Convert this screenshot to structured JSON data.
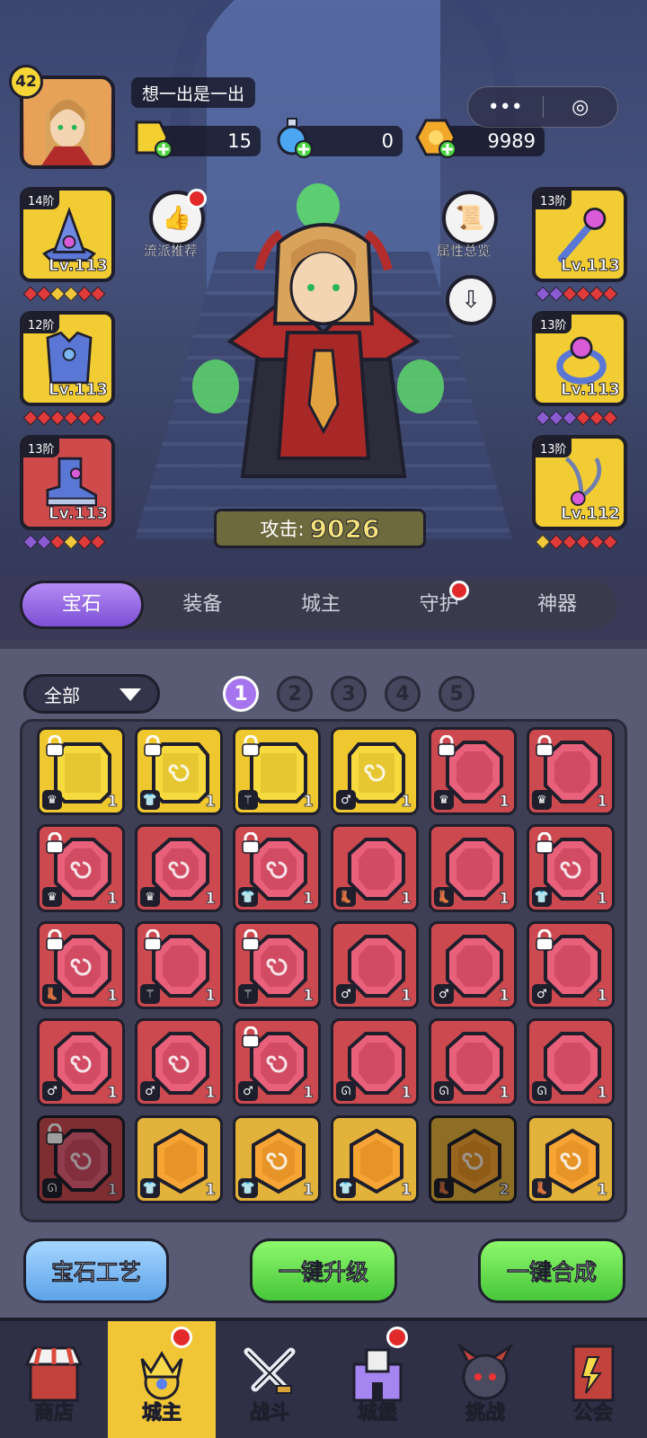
{
  "player": {
    "level": "42",
    "name": "想一出是一出"
  },
  "currencies": [
    {
      "name": "gold-gem",
      "value": "15"
    },
    {
      "name": "potion",
      "value": "0"
    },
    {
      "name": "coin",
      "value": "9989"
    }
  ],
  "mini_buttons": {
    "more": "•••",
    "close": "◎"
  },
  "equipment_left": [
    {
      "tier": "14阶",
      "level": "Lv.113",
      "icon": "hat-icon"
    },
    {
      "tier": "12阶",
      "level": "Lv.113",
      "icon": "armor-icon"
    },
    {
      "tier": "13阶",
      "level": "Lv.113",
      "icon": "boot-icon"
    }
  ],
  "equipment_right": [
    {
      "tier": "13阶",
      "level": "Lv.113",
      "icon": "staff-icon"
    },
    {
      "tier": "13阶",
      "level": "Lv.113",
      "icon": "ring-icon"
    },
    {
      "tier": "13阶",
      "level": "Lv.112",
      "icon": "necklace-icon"
    }
  ],
  "side_buttons": {
    "recommend": "流派推荐",
    "attributes": "属性总览"
  },
  "attack": {
    "label": "攻击:",
    "value": "9026"
  },
  "tabs": [
    "宝石",
    "装备",
    "城主",
    "守护",
    "神器"
  ],
  "filter": {
    "label": "全部"
  },
  "pages": [
    "1",
    "2",
    "3",
    "4",
    "5"
  ],
  "gems": [
    {
      "color": "yellow",
      "lock": true,
      "slot": "♛",
      "count": "1",
      "shape": "rect",
      "mark": false
    },
    {
      "color": "yellow",
      "lock": true,
      "slot": "👕",
      "count": "1",
      "shape": "rect",
      "mark": true
    },
    {
      "color": "yellow",
      "lock": true,
      "slot": "⚚",
      "count": "1",
      "shape": "rect",
      "mark": false
    },
    {
      "color": "yellow",
      "lock": false,
      "slot": "♂",
      "count": "1",
      "shape": "rect",
      "mark": true
    },
    {
      "color": "red",
      "lock": true,
      "slot": "♛",
      "count": "1",
      "shape": "oct",
      "mark": false
    },
    {
      "color": "red",
      "lock": true,
      "slot": "♛",
      "count": "1",
      "shape": "oct",
      "mark": false
    },
    {
      "color": "red",
      "lock": true,
      "slot": "♛",
      "count": "1",
      "shape": "oct",
      "mark": true
    },
    {
      "color": "red",
      "lock": false,
      "slot": "♛",
      "count": "1",
      "shape": "oct",
      "mark": true
    },
    {
      "color": "red",
      "lock": true,
      "slot": "👕",
      "count": "1",
      "shape": "oct",
      "mark": true
    },
    {
      "color": "red",
      "lock": false,
      "slot": "👢",
      "count": "1",
      "shape": "oct",
      "mark": false
    },
    {
      "color": "red",
      "lock": false,
      "slot": "👢",
      "count": "1",
      "shape": "oct",
      "mark": false
    },
    {
      "color": "red",
      "lock": true,
      "slot": "👕",
      "count": "1",
      "shape": "oct",
      "mark": true
    },
    {
      "color": "red",
      "lock": true,
      "slot": "👢",
      "count": "1",
      "shape": "oct",
      "mark": true
    },
    {
      "color": "red",
      "lock": true,
      "slot": "⚚",
      "count": "1",
      "shape": "oct",
      "mark": false
    },
    {
      "color": "red",
      "lock": true,
      "slot": "⚚",
      "count": "1",
      "shape": "oct",
      "mark": true
    },
    {
      "color": "red",
      "lock": false,
      "slot": "♂",
      "count": "1",
      "shape": "oct",
      "mark": false
    },
    {
      "color": "red",
      "lock": false,
      "slot": "♂",
      "count": "1",
      "shape": "oct",
      "mark": false
    },
    {
      "color": "red",
      "lock": true,
      "slot": "♂",
      "count": "1",
      "shape": "oct",
      "mark": false
    },
    {
      "color": "red",
      "lock": false,
      "slot": "♂",
      "count": "1",
      "shape": "oct",
      "mark": true
    },
    {
      "color": "red",
      "lock": false,
      "slot": "♂",
      "count": "1",
      "shape": "oct",
      "mark": true
    },
    {
      "color": "red",
      "lock": true,
      "slot": "♂",
      "count": "1",
      "shape": "oct",
      "mark": true
    },
    {
      "color": "red",
      "lock": false,
      "slot": "ᘏ",
      "count": "1",
      "shape": "oct",
      "mark": false
    },
    {
      "color": "red",
      "lock": false,
      "slot": "ᘏ",
      "count": "1",
      "shape": "oct",
      "mark": false
    },
    {
      "color": "red",
      "lock": false,
      "slot": "ᘏ",
      "count": "1",
      "shape": "oct",
      "mark": false
    },
    {
      "color": "red",
      "dark": true,
      "lock": true,
      "slot": "ᘏ",
      "count": "1",
      "shape": "oct",
      "mark": true
    },
    {
      "color": "orange",
      "lock": false,
      "slot": "👕",
      "count": "1",
      "shape": "hex",
      "mark": false
    },
    {
      "color": "orange",
      "lock": false,
      "slot": "👕",
      "count": "1",
      "shape": "hex",
      "mark": true
    },
    {
      "color": "orange",
      "lock": false,
      "slot": "👕",
      "count": "1",
      "shape": "hex",
      "mark": false
    },
    {
      "color": "orange",
      "dark": true,
      "lock": false,
      "slot": "👢",
      "count": "2",
      "shape": "hex",
      "mark": true
    },
    {
      "color": "orange",
      "lock": false,
      "slot": "👢",
      "count": "1",
      "shape": "hex",
      "mark": true
    }
  ],
  "actions": {
    "craft": "宝石工艺",
    "upgrade": "一键升级",
    "merge": "一键合成"
  },
  "nav": [
    {
      "label": "商店",
      "icon": "shop-icon",
      "active": false,
      "dot": false
    },
    {
      "label": "城主",
      "icon": "lord-icon",
      "active": true,
      "dot": true
    },
    {
      "label": "战斗",
      "icon": "swords-icon",
      "active": false,
      "dot": false
    },
    {
      "label": "城堡",
      "icon": "castle-icon",
      "active": false,
      "dot": true
    },
    {
      "label": "挑战",
      "icon": "demon-icon",
      "active": false,
      "dot": false
    },
    {
      "label": "公会",
      "icon": "guild-icon",
      "active": false,
      "dot": false
    }
  ],
  "colors": {
    "accent_purple": "#a774f0",
    "gem_red": "#cc4a4f",
    "gem_yellow": "#efc82f",
    "gem_orange": "#e3b23a",
    "nav_active": "#f1c636"
  }
}
